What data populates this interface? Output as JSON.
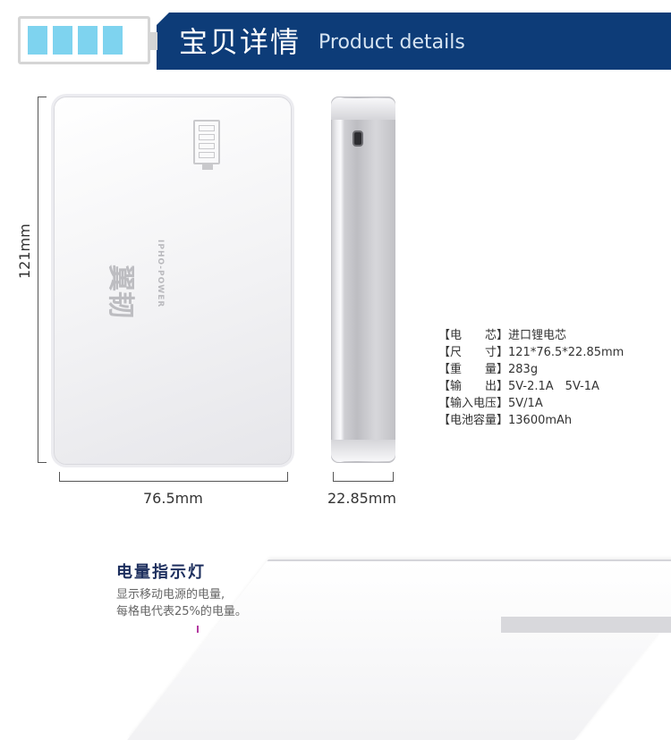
{
  "header": {
    "title_cn": "宝贝详情",
    "title_en": "Product details",
    "battery_icon": "battery-4-cells",
    "accent_color": "#0d3c78",
    "cell_color": "#7ed3ef"
  },
  "dimensions": {
    "height": "121mm",
    "width": "76.5mm",
    "thickness": "22.85mm"
  },
  "product": {
    "logo_cn": "翼韧",
    "logo_en": "IPHO-POWER"
  },
  "specs": [
    {
      "label": "【电　　芯】",
      "value": "进口锂电芯"
    },
    {
      "label": "【尺　　寸】",
      "value": "121*76.5*22.85mm"
    },
    {
      "label": "【重　　量】",
      "value": "283g"
    },
    {
      "label": "【输　　出】",
      "value": "5V-2.1A　5V-1A"
    },
    {
      "label": "【输入电压】",
      "value": "5V/1A"
    },
    {
      "label": "【电池容量】",
      "value": "13600mAh"
    }
  ],
  "indicator": {
    "title": "电量指示灯",
    "desc_line1": "显示移动电源的电量,",
    "desc_line2": "每格电代表25%的电量。"
  }
}
